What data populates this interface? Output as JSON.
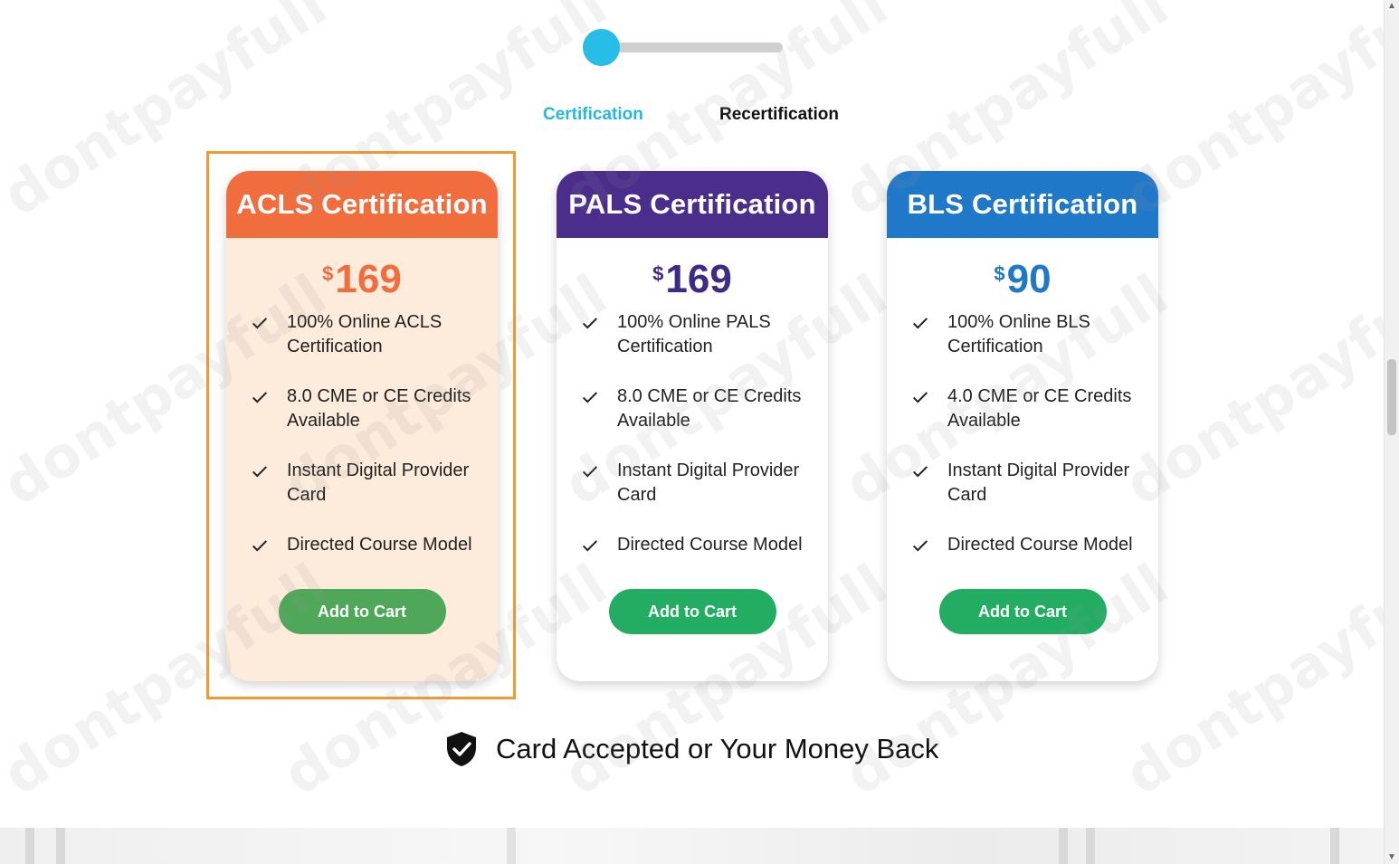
{
  "tabs": {
    "certification": "Certification",
    "recertification": "Recertification"
  },
  "cards": [
    {
      "title": "ACLS Certification",
      "currency": "$",
      "price": "169",
      "header_color": "#f26d3d",
      "price_color": "#f26d3d",
      "features": [
        "100% Online ACLS Certification",
        "8.0 CME or CE Credits Available",
        "Instant Digital Provider Card",
        "Directed Course Model"
      ],
      "button": "Add to Cart"
    },
    {
      "title": "PALS Certification",
      "currency": "$",
      "price": "169",
      "header_color": "#4b2d8c",
      "price_color": "#3f2a86",
      "features": [
        "100% Online PALS Certification",
        "8.0 CME or CE Credits Available",
        "Instant Digital Provider Card",
        "Directed Course Model"
      ],
      "button": "Add to Cart"
    },
    {
      "title": "BLS Certification",
      "currency": "$",
      "price": "90",
      "header_color": "#1f78c8",
      "price_color": "#1f78c8",
      "features": [
        "100% Online BLS Certification",
        "4.0 CME or CE Credits Available",
        "Instant Digital Provider Card",
        "Directed Course Model"
      ],
      "button": "Add to Cart"
    }
  ],
  "guarantee": "Card Accepted or Your Money Back",
  "watermark": "dontpayfull",
  "colors": {
    "toggle_accent": "#27bde6",
    "highlight_border": "#f2992f"
  }
}
